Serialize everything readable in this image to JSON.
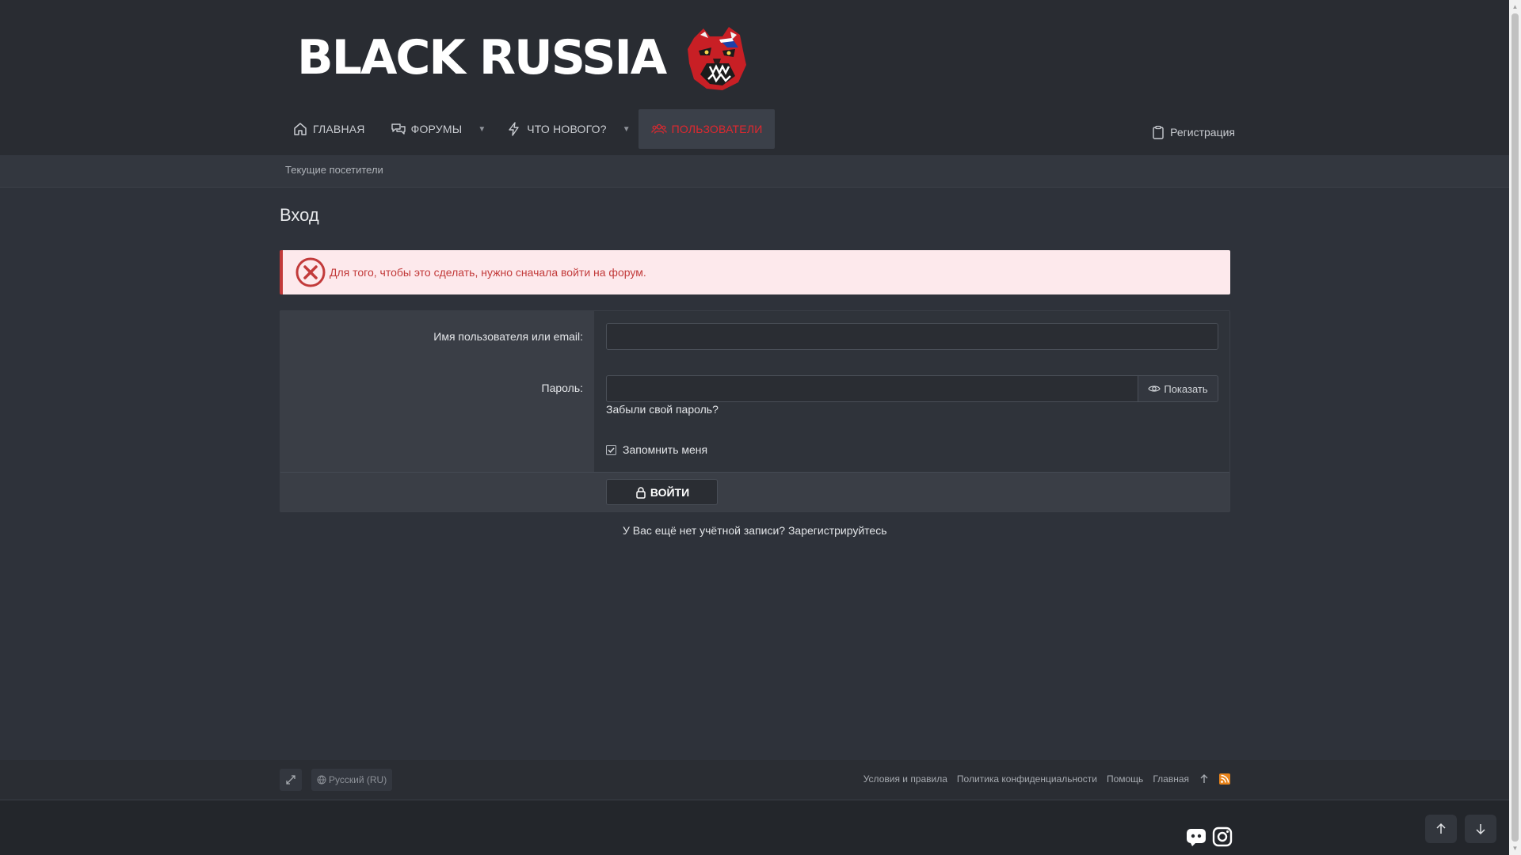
{
  "header": {
    "logo_text": "BLACK RUSSIA",
    "nav": [
      {
        "label": "Главная",
        "icon": "home-icon"
      },
      {
        "label": "Форумы",
        "icon": "comments-icon"
      },
      {
        "label": "Что нового?",
        "icon": "bolt-icon"
      },
      {
        "label": "Пользователи",
        "icon": "users-icon",
        "active": true
      }
    ],
    "register_label": "Регистрация",
    "subnav_link": "Текущие посетители"
  },
  "main": {
    "title": "Вход",
    "alert_text": "Для того, чтобы это сделать, нужно сначала войти на форум.",
    "username_label": "Имя пользователя или email:",
    "username_value": "",
    "password_label": "Пароль:",
    "password_value": "",
    "show_label": "Показать",
    "forgot_label": "Забыли свой пароль?",
    "remember_label": "Запомнить меня",
    "remember_checked": true,
    "login_label": "ВОЙТИ",
    "no_account_text": "У Вас ещё нет учётной записи?",
    "signup_link": "Зарегистрируйтесь"
  },
  "footer": {
    "language": "Русский (RU)",
    "links": [
      "Условия и правила",
      "Политика конфиденциальности",
      "Помощь",
      "Главная"
    ]
  },
  "colors": {
    "accent_red": "#e0282f",
    "header_bg": "#292c32",
    "alert_bg": "#fde9ec",
    "alert_text": "#c23a3a"
  }
}
